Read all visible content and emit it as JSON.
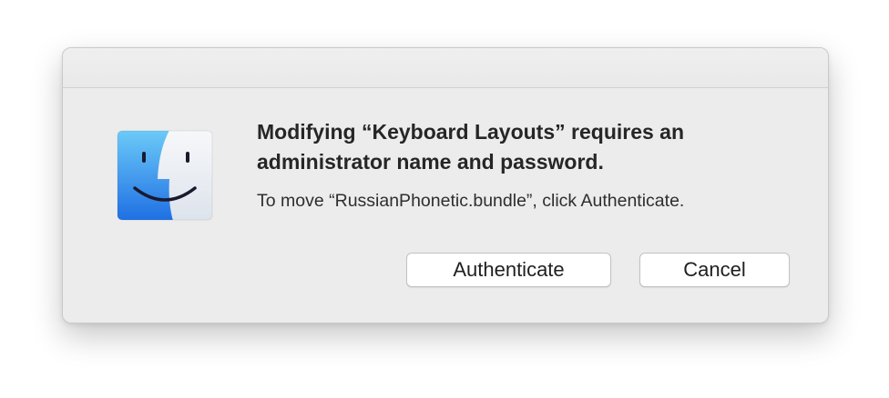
{
  "dialog": {
    "icon": "finder-icon",
    "headline": "Modifying “Keyboard Layouts” requires an administrator name and password.",
    "message": "To move “RussianPhonetic.bundle”, click Authenticate.",
    "buttons": {
      "authenticate": "Authenticate",
      "cancel": "Cancel"
    }
  },
  "colors": {
    "finder_left": "#3d9bf0",
    "finder_right": "#e6ebf2",
    "dialog_bg": "#ececec"
  }
}
